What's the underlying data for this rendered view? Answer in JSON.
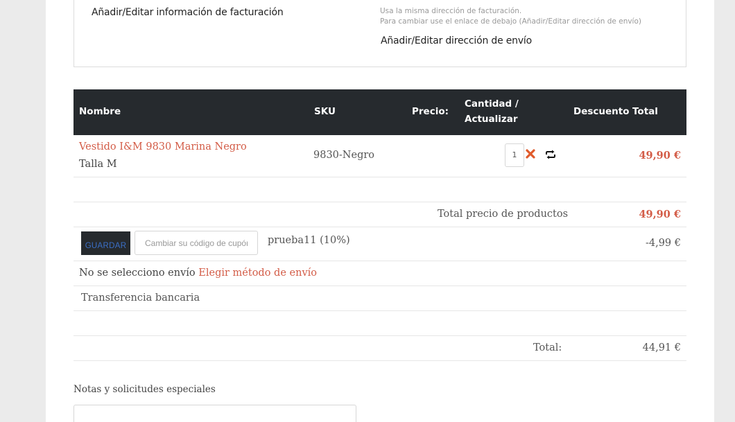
{
  "address": {
    "billing_link": "Añadir/Editar información de facturación",
    "shipping_note_line1": "Usa la misma dirección de facturación.",
    "shipping_note_line2": "Para cambiar use el enlace de debajo (Añadir/Editar dirección de envío)",
    "shipping_link": "Añadir/Editar dirección de envío"
  },
  "cart": {
    "headers": {
      "name": "Nombre",
      "sku": "SKU",
      "price": "Precio:",
      "quantity_line1": "Cantidad /",
      "quantity_line2": "Actualizar",
      "discount": "Descuento",
      "total": "Total"
    },
    "items": [
      {
        "name": "Vestido I&M 9830 Marina Negro",
        "variant": "Talla M",
        "sku": "9830-Negro",
        "quantity": "1",
        "total": "49,90 €"
      }
    ],
    "subtotal_label": "Total precio de productos",
    "subtotal_value": "49,90 €",
    "coupon": {
      "save_label": "GUARDAR",
      "placeholder": "Cambiar su código de cupón",
      "applied": "prueba11 (10%)",
      "discount_value": "-4,99 €"
    },
    "shipping": {
      "status": "No se selecciono envío",
      "choose_link": "Elegir método de envío"
    },
    "payment_method": "Transferencia bancaria",
    "total_label": "Total:",
    "total_value": "44,91 €"
  },
  "notes": {
    "label": "Notas y solicitudes especiales"
  },
  "colors": {
    "accent": "#d35c47",
    "header_bg": "#262a2e",
    "button_text": "#3b6fc7"
  },
  "icons": {
    "remove": "remove-x-icon",
    "update": "refresh-icon"
  }
}
